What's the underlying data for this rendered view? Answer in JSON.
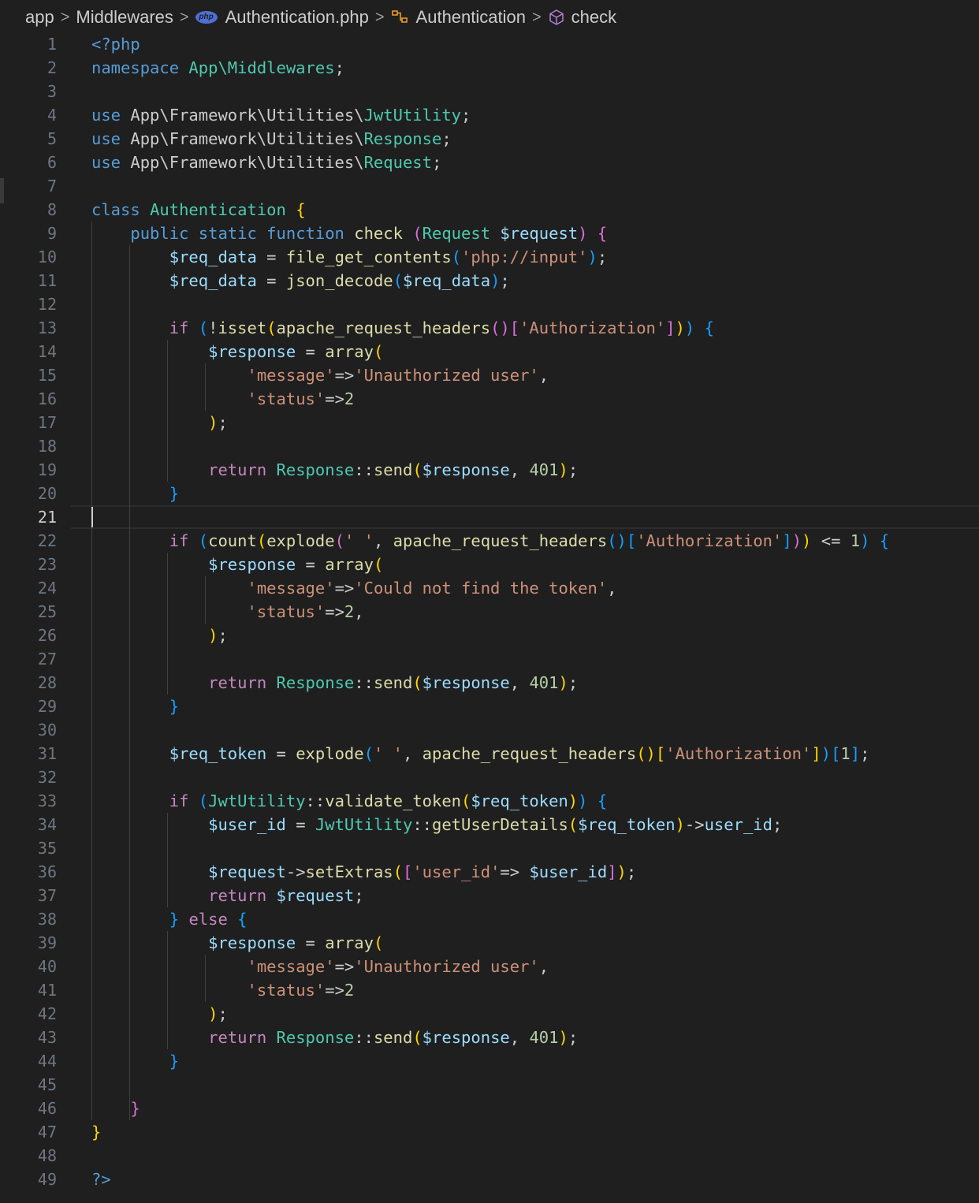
{
  "breadcrumb": {
    "items": [
      "app",
      "Middlewares",
      "Authentication.php",
      "Authentication",
      "check"
    ],
    "file_badge": "php"
  },
  "editor": {
    "language": "php",
    "current_line": 21,
    "lines": [
      [
        [
          "<?php",
          "kw"
        ]
      ],
      [
        [
          "namespace ",
          "kw"
        ],
        [
          "App\\Middlewares",
          "cls"
        ],
        [
          ";",
          "txt"
        ]
      ],
      [],
      [
        [
          "use ",
          "kw"
        ],
        [
          "App\\Framework\\Utilities\\",
          "txt"
        ],
        [
          "JwtUtility",
          "cls"
        ],
        [
          ";",
          "txt"
        ]
      ],
      [
        [
          "use ",
          "kw"
        ],
        [
          "App\\Framework\\Utilities\\",
          "txt"
        ],
        [
          "Response",
          "cls"
        ],
        [
          ";",
          "txt"
        ]
      ],
      [
        [
          "use ",
          "kw"
        ],
        [
          "App\\Framework\\Utilities\\",
          "txt"
        ],
        [
          "Request",
          "cls"
        ],
        [
          ";",
          "txt"
        ]
      ],
      [],
      [
        [
          "class ",
          "kw"
        ],
        [
          "Authentication ",
          "cls"
        ],
        [
          "{",
          "b1"
        ]
      ],
      [
        [
          "    ",
          "txt"
        ],
        [
          "public static function ",
          "kw"
        ],
        [
          "check ",
          "fn"
        ],
        [
          "(",
          "b2"
        ],
        [
          "Request ",
          "cls"
        ],
        [
          "$request",
          "var"
        ],
        [
          ") ",
          "b2"
        ],
        [
          "{",
          "b2"
        ]
      ],
      [
        [
          "        ",
          "txt"
        ],
        [
          "$req_data",
          "var"
        ],
        [
          " = ",
          "txt"
        ],
        [
          "file_get_contents",
          "fn"
        ],
        [
          "(",
          "b3"
        ],
        [
          "'php://input'",
          "str"
        ],
        [
          ")",
          "b3"
        ],
        [
          ";",
          "txt"
        ]
      ],
      [
        [
          "        ",
          "txt"
        ],
        [
          "$req_data",
          "var"
        ],
        [
          " = ",
          "txt"
        ],
        [
          "json_decode",
          "fn"
        ],
        [
          "(",
          "b3"
        ],
        [
          "$req_data",
          "var"
        ],
        [
          ")",
          "b3"
        ],
        [
          ";",
          "txt"
        ]
      ],
      [],
      [
        [
          "        ",
          "txt"
        ],
        [
          "if ",
          "ctl"
        ],
        [
          "(",
          "b3"
        ],
        [
          "!",
          "txt"
        ],
        [
          "isset",
          "fn"
        ],
        [
          "(",
          "b1"
        ],
        [
          "apache_request_headers",
          "fn"
        ],
        [
          "()",
          "b2"
        ],
        [
          "[",
          "b2"
        ],
        [
          "'Authorization'",
          "str"
        ],
        [
          "]",
          "b2"
        ],
        [
          ")",
          "b1"
        ],
        [
          ") ",
          "b3"
        ],
        [
          "{",
          "b3"
        ]
      ],
      [
        [
          "            ",
          "txt"
        ],
        [
          "$response",
          "var"
        ],
        [
          " = ",
          "txt"
        ],
        [
          "array",
          "fn"
        ],
        [
          "(",
          "b1"
        ]
      ],
      [
        [
          "                ",
          "txt"
        ],
        [
          "'message'",
          "str"
        ],
        [
          "=>",
          "txt"
        ],
        [
          "'Unauthorized user'",
          "str"
        ],
        [
          ",",
          "txt"
        ]
      ],
      [
        [
          "                ",
          "txt"
        ],
        [
          "'status'",
          "str"
        ],
        [
          "=>",
          "txt"
        ],
        [
          "2",
          "num"
        ]
      ],
      [
        [
          "            ",
          "txt"
        ],
        [
          ")",
          "b1"
        ],
        [
          ";",
          "txt"
        ]
      ],
      [],
      [
        [
          "            ",
          "txt"
        ],
        [
          "return ",
          "ctl"
        ],
        [
          "Response",
          "cls"
        ],
        [
          "::",
          "txt"
        ],
        [
          "send",
          "fn"
        ],
        [
          "(",
          "b1"
        ],
        [
          "$response",
          "var"
        ],
        [
          ", ",
          "txt"
        ],
        [
          "401",
          "num"
        ],
        [
          ")",
          "b1"
        ],
        [
          ";",
          "txt"
        ]
      ],
      [
        [
          "        ",
          "txt"
        ],
        [
          "}",
          "b3"
        ]
      ],
      [],
      [
        [
          "        ",
          "txt"
        ],
        [
          "if ",
          "ctl"
        ],
        [
          "(",
          "b3"
        ],
        [
          "count",
          "fn"
        ],
        [
          "(",
          "b1"
        ],
        [
          "explode",
          "fn"
        ],
        [
          "(",
          "b2"
        ],
        [
          "' '",
          "str"
        ],
        [
          ", ",
          "txt"
        ],
        [
          "apache_request_headers",
          "fn"
        ],
        [
          "()",
          "b3"
        ],
        [
          "[",
          "b3"
        ],
        [
          "'Authorization'",
          "str"
        ],
        [
          "]",
          "b3"
        ],
        [
          ")",
          "b2"
        ],
        [
          ")",
          "b1"
        ],
        [
          " <= ",
          "txt"
        ],
        [
          "1",
          "num"
        ],
        [
          ") ",
          "b3"
        ],
        [
          "{",
          "b3"
        ]
      ],
      [
        [
          "            ",
          "txt"
        ],
        [
          "$response",
          "var"
        ],
        [
          " = ",
          "txt"
        ],
        [
          "array",
          "fn"
        ],
        [
          "(",
          "b1"
        ]
      ],
      [
        [
          "                ",
          "txt"
        ],
        [
          "'message'",
          "str"
        ],
        [
          "=>",
          "txt"
        ],
        [
          "'Could not find the token'",
          "str"
        ],
        [
          ",",
          "txt"
        ]
      ],
      [
        [
          "                ",
          "txt"
        ],
        [
          "'status'",
          "str"
        ],
        [
          "=>",
          "txt"
        ],
        [
          "2",
          "num"
        ],
        [
          ",",
          "txt"
        ]
      ],
      [
        [
          "            ",
          "txt"
        ],
        [
          ")",
          "b1"
        ],
        [
          ";",
          "txt"
        ]
      ],
      [],
      [
        [
          "            ",
          "txt"
        ],
        [
          "return ",
          "ctl"
        ],
        [
          "Response",
          "cls"
        ],
        [
          "::",
          "txt"
        ],
        [
          "send",
          "fn"
        ],
        [
          "(",
          "b1"
        ],
        [
          "$response",
          "var"
        ],
        [
          ", ",
          "txt"
        ],
        [
          "401",
          "num"
        ],
        [
          ")",
          "b1"
        ],
        [
          ";",
          "txt"
        ]
      ],
      [
        [
          "        ",
          "txt"
        ],
        [
          "}",
          "b3"
        ]
      ],
      [],
      [
        [
          "        ",
          "txt"
        ],
        [
          "$req_token",
          "var"
        ],
        [
          " = ",
          "txt"
        ],
        [
          "explode",
          "fn"
        ],
        [
          "(",
          "b3"
        ],
        [
          "' '",
          "str"
        ],
        [
          ", ",
          "txt"
        ],
        [
          "apache_request_headers",
          "fn"
        ],
        [
          "()",
          "b1"
        ],
        [
          "[",
          "b1"
        ],
        [
          "'Authorization'",
          "str"
        ],
        [
          "]",
          "b1"
        ],
        [
          ")",
          "b3"
        ],
        [
          "[",
          "b3"
        ],
        [
          "1",
          "num"
        ],
        [
          "]",
          "b3"
        ],
        [
          ";",
          "txt"
        ]
      ],
      [],
      [
        [
          "        ",
          "txt"
        ],
        [
          "if ",
          "ctl"
        ],
        [
          "(",
          "b3"
        ],
        [
          "JwtUtility",
          "cls"
        ],
        [
          "::",
          "txt"
        ],
        [
          "validate_token",
          "fn"
        ],
        [
          "(",
          "b1"
        ],
        [
          "$req_token",
          "var"
        ],
        [
          ")",
          "b1"
        ],
        [
          ") ",
          "b3"
        ],
        [
          "{",
          "b3"
        ]
      ],
      [
        [
          "            ",
          "txt"
        ],
        [
          "$user_id",
          "var"
        ],
        [
          " = ",
          "txt"
        ],
        [
          "JwtUtility",
          "cls"
        ],
        [
          "::",
          "txt"
        ],
        [
          "getUserDetails",
          "fn"
        ],
        [
          "(",
          "b1"
        ],
        [
          "$req_token",
          "var"
        ],
        [
          ")",
          "b1"
        ],
        [
          "->",
          "txt"
        ],
        [
          "user_id",
          "var"
        ],
        [
          ";",
          "txt"
        ]
      ],
      [],
      [
        [
          "            ",
          "txt"
        ],
        [
          "$request",
          "var"
        ],
        [
          "->",
          "txt"
        ],
        [
          "setExtras",
          "fn"
        ],
        [
          "(",
          "b1"
        ],
        [
          "[",
          "b2"
        ],
        [
          "'user_id'",
          "str"
        ],
        [
          "=> ",
          "txt"
        ],
        [
          "$user_id",
          "var"
        ],
        [
          "]",
          "b2"
        ],
        [
          ")",
          "b1"
        ],
        [
          ";",
          "txt"
        ]
      ],
      [
        [
          "            ",
          "txt"
        ],
        [
          "return ",
          "ctl"
        ],
        [
          "$request",
          "var"
        ],
        [
          ";",
          "txt"
        ]
      ],
      [
        [
          "        ",
          "txt"
        ],
        [
          "} ",
          "b3"
        ],
        [
          "else ",
          "ctl"
        ],
        [
          "{",
          "b3"
        ]
      ],
      [
        [
          "            ",
          "txt"
        ],
        [
          "$response",
          "var"
        ],
        [
          " = ",
          "txt"
        ],
        [
          "array",
          "fn"
        ],
        [
          "(",
          "b1"
        ]
      ],
      [
        [
          "                ",
          "txt"
        ],
        [
          "'message'",
          "str"
        ],
        [
          "=>",
          "txt"
        ],
        [
          "'Unauthorized user'",
          "str"
        ],
        [
          ",",
          "txt"
        ]
      ],
      [
        [
          "                ",
          "txt"
        ],
        [
          "'status'",
          "str"
        ],
        [
          "=>",
          "txt"
        ],
        [
          "2",
          "num"
        ]
      ],
      [
        [
          "            ",
          "txt"
        ],
        [
          ")",
          "b1"
        ],
        [
          ";",
          "txt"
        ]
      ],
      [
        [
          "            ",
          "txt"
        ],
        [
          "return ",
          "ctl"
        ],
        [
          "Response",
          "cls"
        ],
        [
          "::",
          "txt"
        ],
        [
          "send",
          "fn"
        ],
        [
          "(",
          "b1"
        ],
        [
          "$response",
          "var"
        ],
        [
          ", ",
          "txt"
        ],
        [
          "401",
          "num"
        ],
        [
          ")",
          "b1"
        ],
        [
          ";",
          "txt"
        ]
      ],
      [
        [
          "        ",
          "txt"
        ],
        [
          "}",
          "b3"
        ]
      ],
      [],
      [
        [
          "    ",
          "txt"
        ],
        [
          "}",
          "b2"
        ]
      ],
      [
        [
          "}",
          "b1"
        ]
      ],
      [],
      [
        [
          "?>",
          "kw"
        ]
      ]
    ]
  }
}
